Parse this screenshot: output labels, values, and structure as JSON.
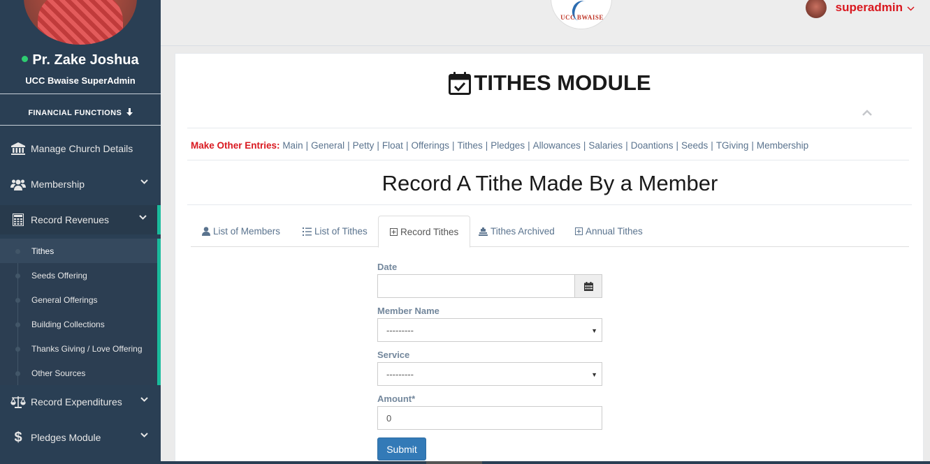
{
  "profile": {
    "name": "Pr. Zake Joshua",
    "role": "UCC Bwaise SuperAdmin"
  },
  "sidebar": {
    "section_title": "FINANCIAL FUNCTIONS",
    "items": [
      {
        "label": "Manage Church Details",
        "icon": "bank-icon"
      },
      {
        "label": "Membership",
        "icon": "users-icon"
      },
      {
        "label": "Record Revenues",
        "icon": "calculator-icon"
      },
      {
        "label": "Record Expenditures",
        "icon": "balance-scale-icon"
      },
      {
        "label": "Pledges Module",
        "icon": "dollar-icon"
      }
    ],
    "revenue_subitems": [
      "Tithes",
      "Seeds Offering",
      "General Offerings",
      "Building Collections",
      "Thanks Giving / Love Offering",
      "Other Sources"
    ]
  },
  "topbar": {
    "logo_text": "UCC BWAISE",
    "username": "superadmin"
  },
  "module": {
    "title": "TITHES MODULE"
  },
  "entries": {
    "lead": "Make Other Entries:",
    "links": [
      "Main",
      "General",
      "Petty",
      "Float",
      "Offerings",
      "Tithes",
      "Pledges",
      "Allowances",
      "Salaries",
      "Doantions",
      "Seeds",
      "TGiving",
      "Membership"
    ]
  },
  "form": {
    "heading": "Record A Tithe Made By a Member",
    "date_label": "Date",
    "date_value": "",
    "member_label": "Member Name",
    "member_value": "---------",
    "service_label": "Service",
    "service_value": "---------",
    "amount_label": "Amount*",
    "amount_value": "0",
    "submit_label": "Submit"
  },
  "tabs": [
    {
      "label": "List of Members",
      "icon": "user-icon"
    },
    {
      "label": "List of Tithes",
      "icon": "list-ol-icon"
    },
    {
      "label": "Record Tithes",
      "icon": "plus-square-icon"
    },
    {
      "label": "Tithes Archived",
      "icon": "archive-icon"
    },
    {
      "label": "Annual Tithes",
      "icon": "plus-square-icon"
    }
  ],
  "colors": {
    "sidebar_bg": "#2a3f54",
    "active_accent": "#1abb9c",
    "brand_red": "#d9181f",
    "link_blue": "#5a738e",
    "button_blue": "#337ab7"
  }
}
